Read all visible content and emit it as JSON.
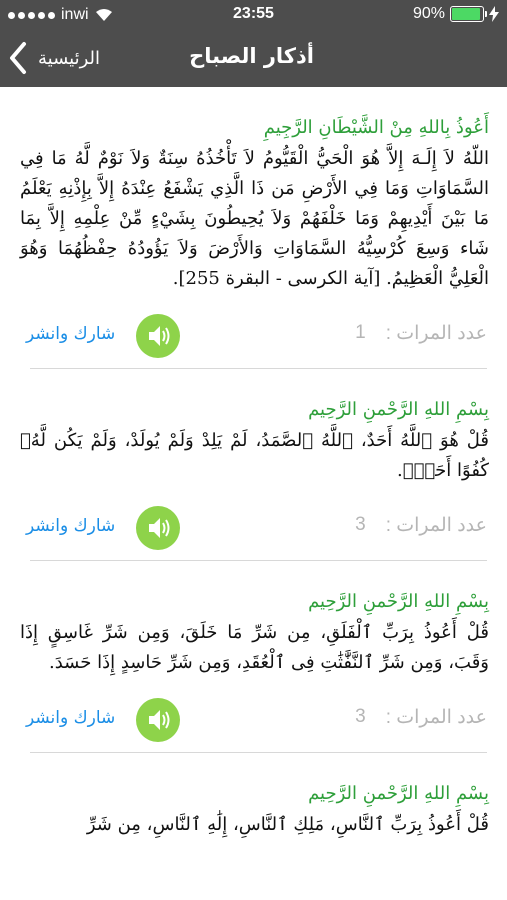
{
  "status": {
    "carrier": "inwi",
    "time": "23:55",
    "battery": "90%",
    "battery_color": "#4cd964"
  },
  "nav": {
    "title": "أذكار الصباح",
    "back_label": "الرئيسية"
  },
  "items": [
    {
      "heading": "أَعُوذُ بِاللهِ مِنْ الشَّيْطَانِ الرَّجِيمِ",
      "text": "اللّهُ لاَ إِلَـهَ إِلاَّ هُوَ الْحَيُّ الْقَيُّومُ لاَ تَأْخُذُهُ سِنَةٌ وَلاَ نَوْمٌ لَّهُ مَا فِي السَّمَاوَاتِ وَمَا فِي الأَرْضِ مَن ذَا الَّذِي يَشْفَعُ عِنْدَهُ إِلاَّ بِإِذْنِهِ يَعْلَمُ مَا بَيْنَ أَيْدِيهِمْ وَمَا خَلْفَهُمْ وَلاَ يُحِيطُونَ بِشَيْءٍ مِّنْ عِلْمِهِ إِلاَّ بِمَا شَاء وَسِعَ كُرْسِيُّهُ السَّمَاوَاتِ وَالأَرْضَ وَلاَ يَؤُودُهُ حِفْظُهُمَا وَهُوَ الْعَلِيُّ الْعَظِيمُ. [آية الكرسى - البقرة 255].",
      "count_label": "عدد المرات :",
      "count": "1",
      "share": "شارك وانشر"
    },
    {
      "heading": "بِسْمِ اللهِ الرَّحْمنِ الرَّحِيم",
      "text": "قُلْ هُوَ ٱللَّهُ أَحَدٌ، ٱللَّهُ ٱلصَّمَدُ، لَمْ يَلِدْ وَلَمْ يُولَدْ، وَلَمْ يَكُن لَّهُۥ كُفُوًا أَحَدٌۢ.",
      "count_label": "عدد المرات :",
      "count": "3",
      "share": "شارك وانشر"
    },
    {
      "heading": "بِسْمِ اللهِ الرَّحْمنِ الرَّحِيم",
      "text": "قُلْ أَعُوذُ بِرَبِّ ٱلْفَلَقِ، مِن شَرِّ مَا خَلَقَ، وَمِن شَرِّ غَاسِقٍ إِذَا وَقَبَ، وَمِن شَرِّ ٱلنَّفَّٰثَٰتِ فِى ٱلْعُقَدِ، وَمِن شَرِّ حَاسِدٍ إِذَا حَسَدَ.",
      "count_label": "عدد المرات :",
      "count": "3",
      "share": "شارك وانشر"
    },
    {
      "heading": "بِسْمِ اللهِ الرَّحْمنِ الرَّحِيم",
      "text": "قُلْ أَعُوذُ بِرَبِّ ٱلنَّاسِ، مَلِكِ ٱلنَّاسِ، إِلَٰهِ ٱلنَّاسِ، مِن شَرِّ",
      "count_label": "",
      "count": "",
      "share": ""
    }
  ],
  "accent_colors": {
    "green": "#2e9f3a",
    "speaker": "#8ed34a",
    "link": "#1b8ee6",
    "header": "#4d4d4d"
  }
}
